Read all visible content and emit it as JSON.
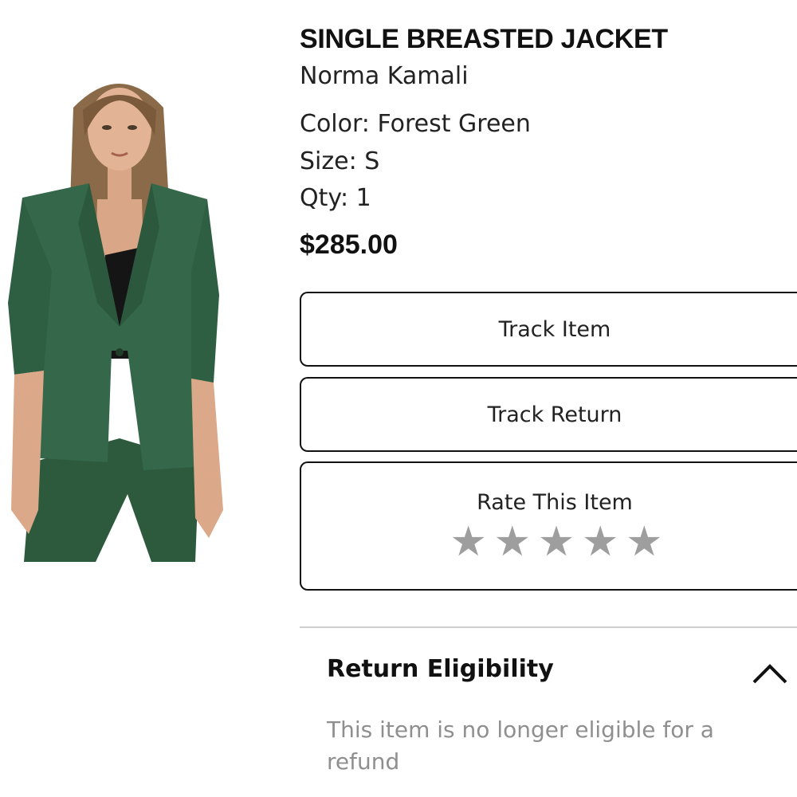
{
  "product": {
    "title": "SINGLE BREASTED JACKET",
    "brand": "Norma Kamali",
    "color_label": "Color: Forest Green",
    "size_label": "Size: S",
    "qty_label": "Qty: 1",
    "price": "$285.00",
    "image": {
      "subject": "model wearing forest green single breasted jacket and trousers",
      "color": "#2f5b3d"
    }
  },
  "actions": {
    "track_item": "Track Item",
    "track_return": "Track Return",
    "rate_item": "Rate This Item",
    "rating": {
      "value": 0,
      "max": 5,
      "star_color": "#9e9e9e"
    }
  },
  "return_eligibility": {
    "title": "Return Eligibility",
    "message": "This item is no longer eligible for a refund",
    "expanded": true,
    "icon": "chevron-up-icon"
  }
}
